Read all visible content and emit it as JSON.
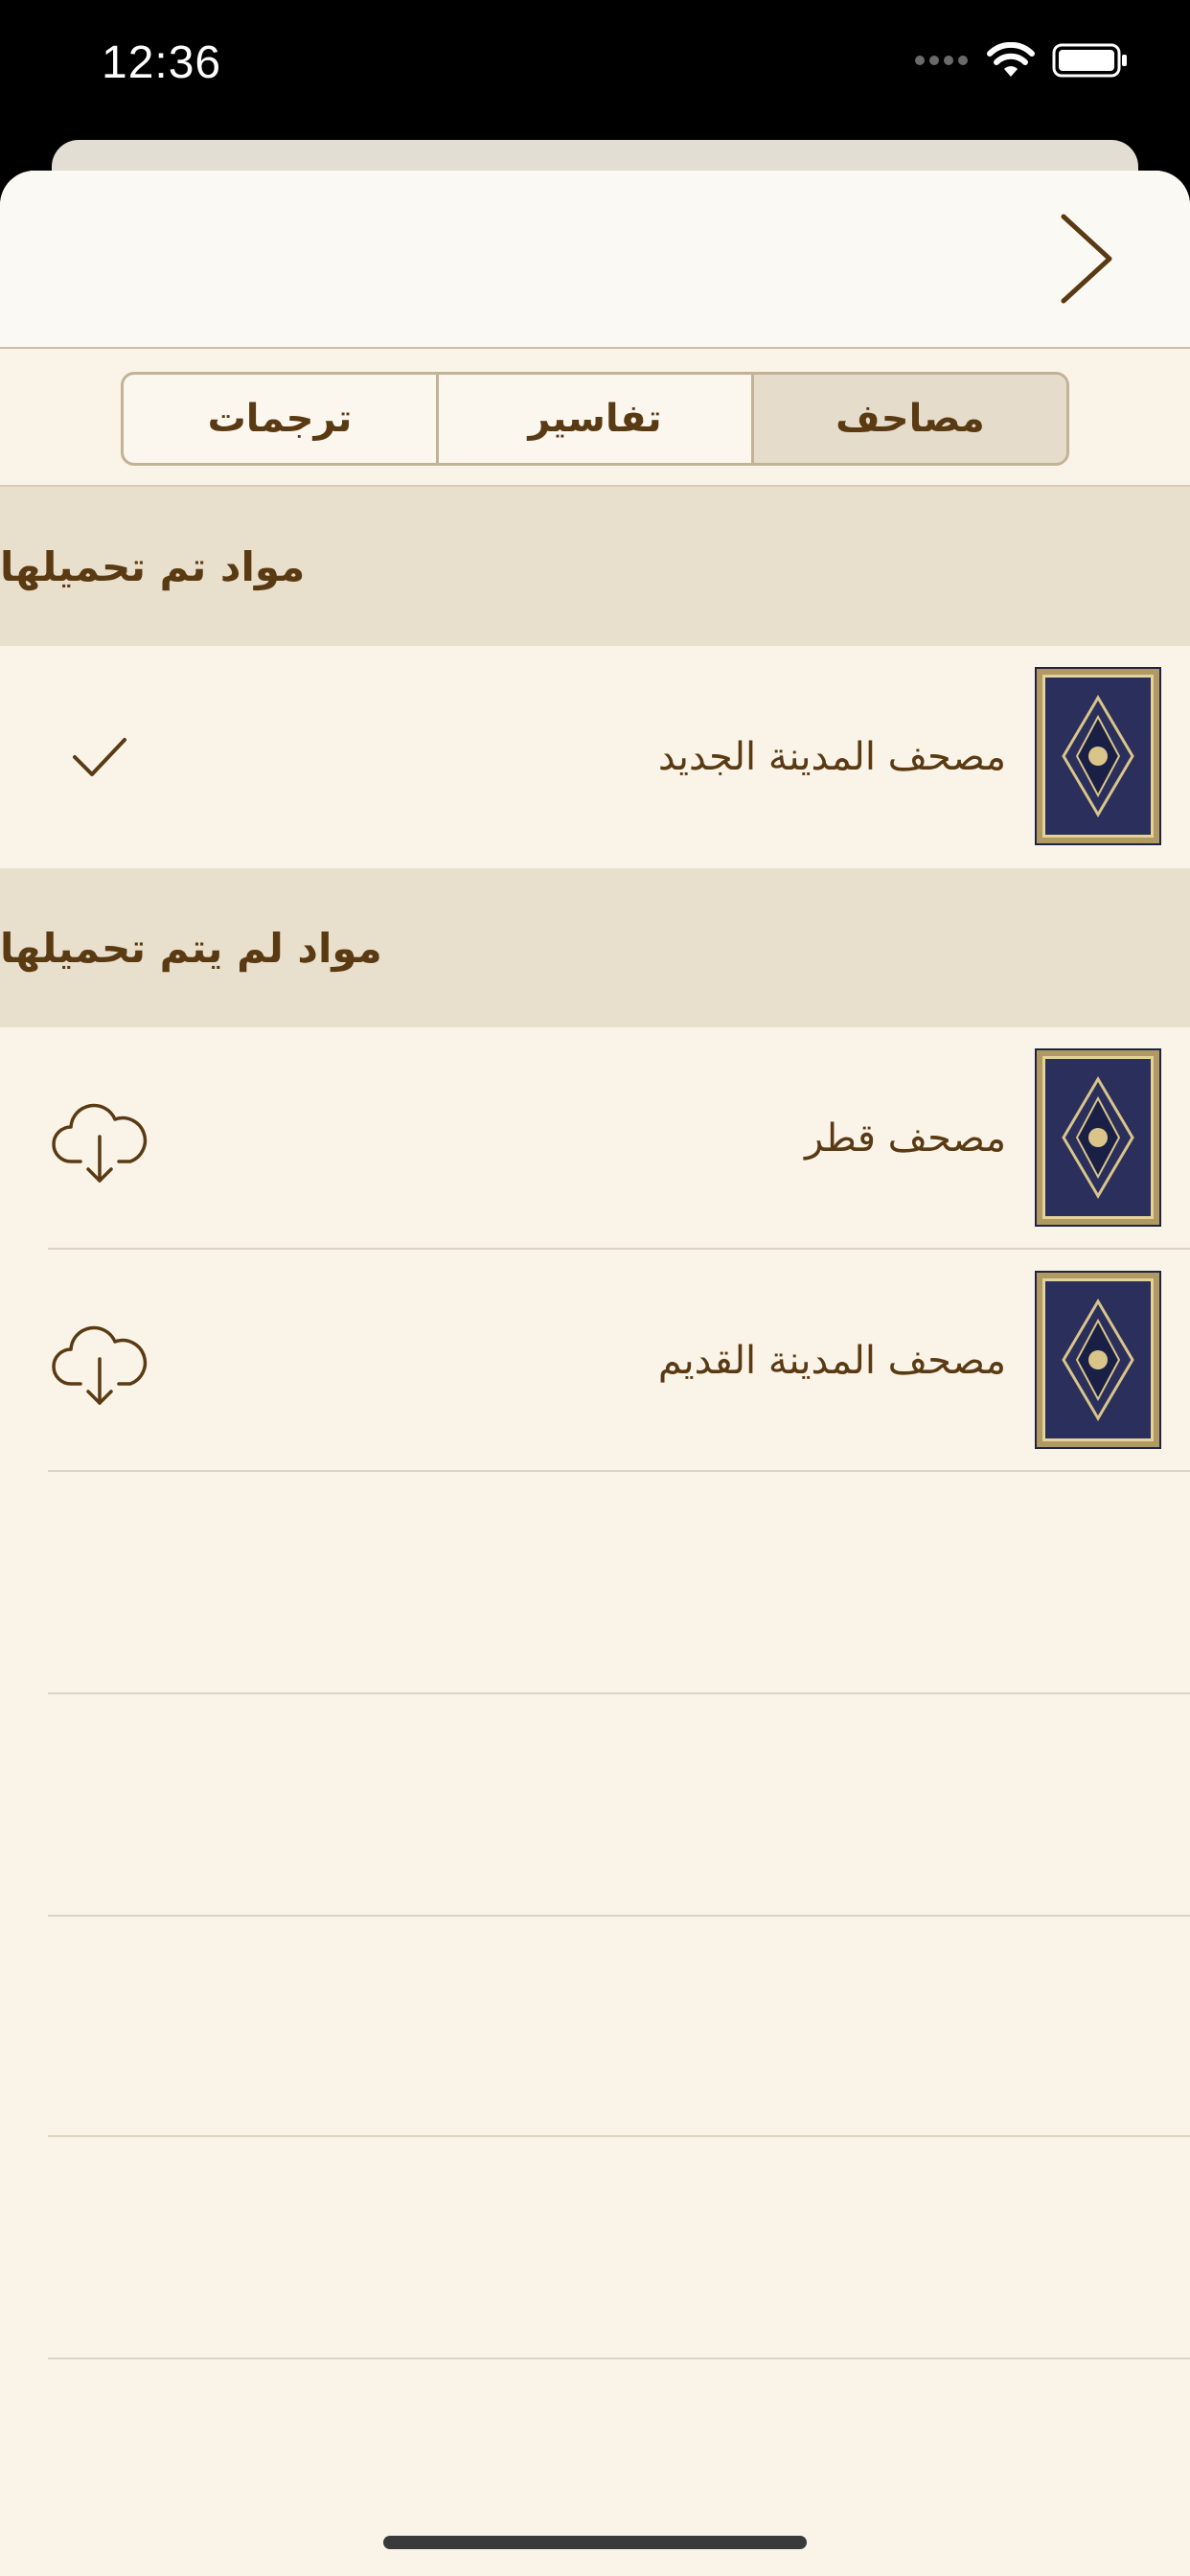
{
  "status_bar": {
    "time": "12:36"
  },
  "nav": {
    "back_icon": "chevron-right-icon"
  },
  "tabs": [
    {
      "label": "مصاحف",
      "selected": true
    },
    {
      "label": "تفاسير",
      "selected": false
    },
    {
      "label": "ترجمات",
      "selected": false
    }
  ],
  "sections": {
    "downloaded": {
      "title": "مواد تم تحميلها",
      "items": [
        {
          "title": "مصحف المدينة الجديد",
          "action_icon": "checkmark-icon"
        }
      ]
    },
    "not_downloaded": {
      "title": "مواد لم يتم تحميلها",
      "items": [
        {
          "title": "مصحف قطر",
          "action_icon": "cloud-download-icon"
        },
        {
          "title": "مصحف المدينة القديم",
          "action_icon": "cloud-download-icon"
        }
      ]
    }
  },
  "colors": {
    "accent": "#5a3a12",
    "background": "#faf3e8",
    "section_header": "#e8dfcd",
    "segment_selected": "#e6dccb"
  }
}
